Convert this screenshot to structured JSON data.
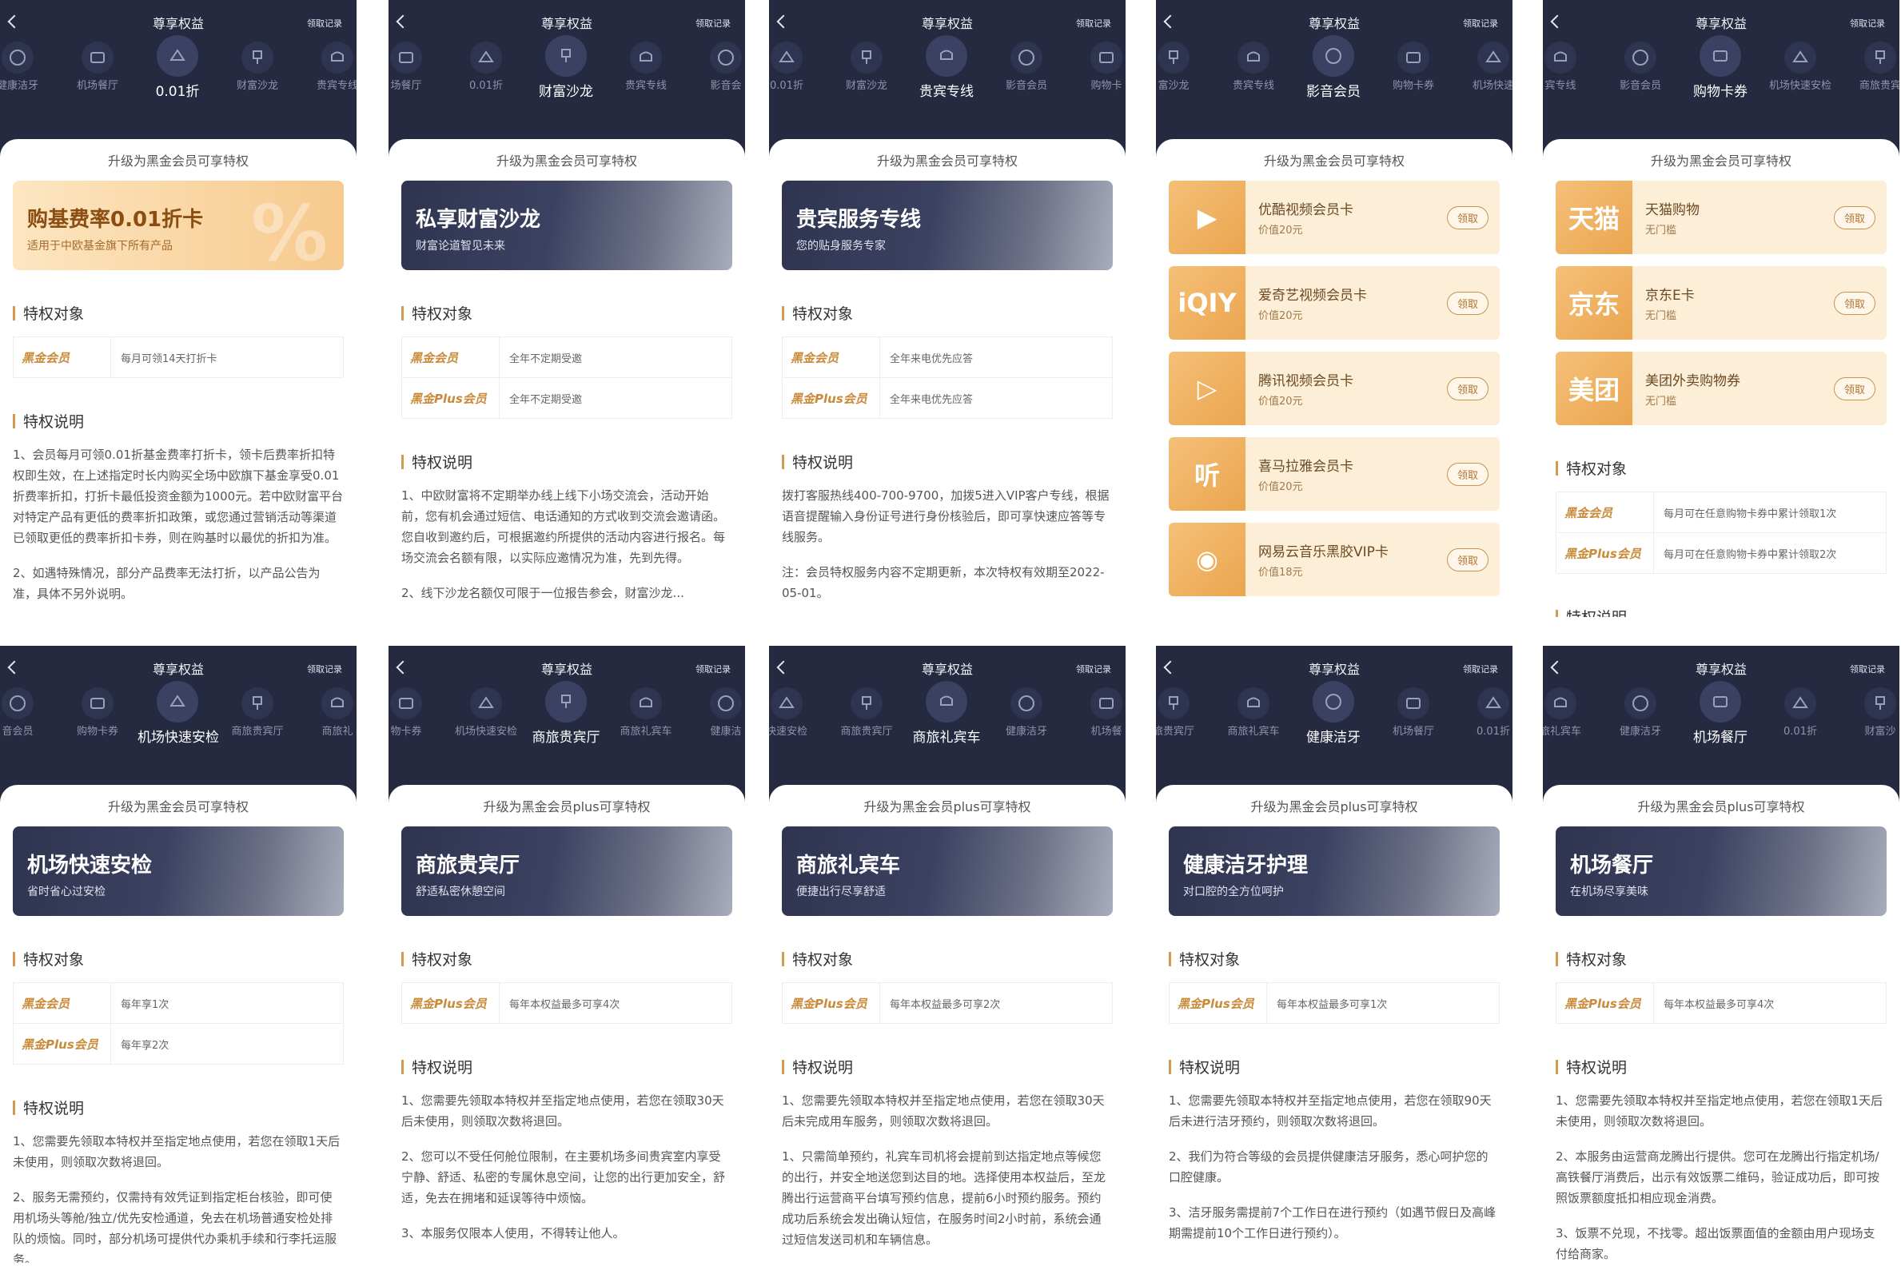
{
  "header": {
    "title": "尊享权益",
    "record": "领取记录",
    "back": "返回"
  },
  "icons": {
    "back": "chevron-left-icon"
  },
  "colors": {
    "header_bg": "#252a40",
    "accent": "#d39a4f",
    "gold_text": "#c98b3a"
  },
  "panels": [
    {
      "tabs": [
        "健康洁牙",
        "机场餐厅",
        "0.01折",
        "财富沙龙",
        "贵宾专线"
      ],
      "upgrade": "升级为黑金会员可享特权",
      "banner": {
        "title": "购基费率0.01折卡",
        "subtitle": "适用于中欧基金旗下所有产品",
        "style": "gold"
      },
      "target_title": "特权对象",
      "targets": [
        {
          "tier": "黑金会员",
          "value": "每月可领14天打折卡"
        }
      ],
      "desc_title": "特权说明",
      "desc": [
        "1、会员每月可领0.01折基金费率打折卡，领卡后费率折扣特权即生效，在上述指定时长内购买全场中欧旗下基金享受0.01折费率折扣，打折卡最低投资金额为1000元。若中欧财富平台对特定产品有更低的费率折扣政策，或您通过营销活动等渠道已领取更低的费率折扣卡券，则在购基时以最优的折扣为准。",
        "2、如遇特殊情况，部分产品费率无法打折，以产品公告为准，具体不另外说明。"
      ]
    },
    {
      "tabs": [
        "场餐厅",
        "0.01折",
        "财富沙龙",
        "贵宾专线",
        "影音会"
      ],
      "upgrade": "升级为黑金会员可享特权",
      "banner": {
        "title": "私享财富沙龙",
        "subtitle": "财富论道智见未来",
        "style": "dark"
      },
      "target_title": "特权对象",
      "targets": [
        {
          "tier": "黑金会员",
          "value": "全年不定期受邀"
        },
        {
          "tier": "黑金Plus会员",
          "value": "全年不定期受邀"
        }
      ],
      "desc_title": "特权说明",
      "desc": [
        "1、中欧财富将不定期举办线上线下小场交流会，活动开始前，您有机会通过短信、电话通知的方式收到交流会邀请函。您自收到邀约后，可根据邀约所提供的活动内容进行报名。每场交流会名额有限，以实际应邀情况为准，先到先得。",
        "2、线下沙龙名额仅可限于一位报告参会，财富沙龙..."
      ]
    },
    {
      "tabs": [
        "0.01折",
        "财富沙龙",
        "贵宾专线",
        "影音会员",
        "购物卡"
      ],
      "upgrade": "升级为黑金会员可享特权",
      "banner": {
        "title": "贵宾服务专线",
        "subtitle": "您的贴身服务专家",
        "style": "dark"
      },
      "target_title": "特权对象",
      "targets": [
        {
          "tier": "黑金会员",
          "value": "全年来电优先应答"
        },
        {
          "tier": "黑金Plus会员",
          "value": "全年来电优先应答"
        }
      ],
      "desc_title": "特权说明",
      "desc": [
        "拨打客服热线400-700-9700，加拨5进入VIP客户专线，根据语音提醒输入身份证号进行身份核验后，即可享快速应答等专线服务。",
        "注：会员特权服务内容不定期更新，本次特权有效期至2022-05-01。"
      ]
    },
    {
      "tabs": [
        "富沙龙",
        "贵宾专线",
        "影音会员",
        "购物卡券",
        "机场快速"
      ],
      "upgrade": "升级为黑金会员可享特权",
      "vouchers": [
        {
          "logo": "▶",
          "name": "优酷视频会员卡",
          "price": "价值20元",
          "btn": "领取"
        },
        {
          "logo": "iQIY",
          "name": "爱奇艺视频会员卡",
          "price": "价值20元",
          "btn": "领取"
        },
        {
          "logo": "▷",
          "name": "腾讯视频会员卡",
          "price": "价值20元",
          "btn": "领取"
        },
        {
          "logo": "听",
          "name": "喜马拉雅会员卡",
          "price": "价值20元",
          "btn": "领取"
        },
        {
          "logo": "◉",
          "name": "网易云音乐黑胶VIP卡",
          "price": "价值18元",
          "btn": "领取"
        }
      ]
    },
    {
      "tabs": [
        "宾专线",
        "影音会员",
        "购物卡券",
        "机场快速安检",
        "商旅贵宾"
      ],
      "upgrade": "升级为黑金会员可享特权",
      "vouchers": [
        {
          "logo": "天猫",
          "name": "天猫购物",
          "price": "无门槛",
          "btn": "领取"
        },
        {
          "logo": "京东",
          "name": "京东E卡",
          "price": "无门槛",
          "btn": "领取"
        },
        {
          "logo": "美团",
          "name": "美团外卖购物券",
          "price": "无门槛",
          "btn": "领取"
        }
      ],
      "target_title": "特权对象",
      "targets": [
        {
          "tier": "黑金会员",
          "value": "每月可在任意购物卡券中累计领取1次"
        },
        {
          "tier": "黑金Plus会员",
          "value": "每月可在任意购物卡券中累计领取2次"
        }
      ],
      "desc_title": "特权说明"
    },
    {
      "tabs": [
        "音会员",
        "购物卡券",
        "机场快速安检",
        "商旅贵宾厅",
        "商旅礼"
      ],
      "upgrade": "升级为黑金会员可享特权",
      "banner": {
        "title": "机场快速安检",
        "subtitle": "省时省心过安检",
        "style": "dark"
      },
      "target_title": "特权对象",
      "targets": [
        {
          "tier": "黑金会员",
          "value": "每年享1次"
        },
        {
          "tier": "黑金Plus会员",
          "value": "每年享2次"
        }
      ],
      "desc_title": "特权说明",
      "desc": [
        "1、您需要先领取本特权并至指定地点使用，若您在领取1天后未使用，则领取次数将退回。",
        "2、服务无需预约，仅需持有效凭证到指定柜台核验，即可使用机场头等舱/独立/优先安检通道，免去在机场普通安检处排队的烦恼。同时，部分机场可提供代办乘机手续和行李托运服务。"
      ]
    },
    {
      "tabs": [
        "物卡券",
        "机场快速安检",
        "商旅贵宾厅",
        "商旅礼宾车",
        "健康洁"
      ],
      "upgrade": "升级为黑金会员plus可享特权",
      "banner": {
        "title": "商旅贵宾厅",
        "subtitle": "舒适私密休憩空间",
        "style": "dark"
      },
      "target_title": "特权对象",
      "targets": [
        {
          "tier": "黑金Plus会员",
          "value": "每年本权益最多可享4次"
        }
      ],
      "desc_title": "特权说明",
      "desc": [
        "1、您需要先领取本特权并至指定地点使用，若您在领取30天后未使用，则领取次数将退回。",
        "2、您可以不受任何舱位限制，在主要机场多间贵宾室内享受宁静、舒适、私密的专属休息空间，让您的出行更加安全，舒适，免去在拥堵和延误等待中烦恼。",
        "3、本服务仅限本人使用，不得转让他人。"
      ]
    },
    {
      "tabs": [
        "快速安检",
        "商旅贵宾厅",
        "商旅礼宾车",
        "健康洁牙",
        "机场餐"
      ],
      "upgrade": "升级为黑金会员plus可享特权",
      "banner": {
        "title": "商旅礼宾车",
        "subtitle": "便捷出行尽享舒适",
        "style": "dark"
      },
      "target_title": "特权对象",
      "targets": [
        {
          "tier": "黑金Plus会员",
          "value": "每年本权益最多可享2次"
        }
      ],
      "desc_title": "特权说明",
      "desc": [
        "1、您需要先领取本特权并至指定地点使用，若您在领取30天后未完成用车服务，则领取次数将退回。",
        "1、只需简单预约，礼宾车司机将会提前到达指定地点等候您的出行，并安全地送您到达目的地。选择使用本权益后，至龙腾出行运营商平台填写预约信息，提前6小时预约服务。预约成功后系统会发出确认短信，在服务时间2小时前，系统会通过短信发送司机和车辆信息。"
      ]
    },
    {
      "tabs": [
        "旅贵宾厅",
        "商旅礼宾车",
        "健康洁牙",
        "机场餐厅",
        "0.01折"
      ],
      "upgrade": "升级为黑金会员plus可享特权",
      "banner": {
        "title": "健康洁牙护理",
        "subtitle": "对口腔的全方位呵护",
        "style": "dark"
      },
      "target_title": "特权对象",
      "targets": [
        {
          "tier": "黑金Plus会员",
          "value": "每年本权益最多可享1次"
        }
      ],
      "desc_title": "特权说明",
      "desc": [
        "1、您需要先领取本特权并至指定地点使用，若您在领取90天后未进行洁牙预约，则领取次数将退回。",
        "2、我们为符合等级的会员提供健康洁牙服务，悉心呵护您的口腔健康。",
        "3、洁牙服务需提前7个工作日在进行预约（如遇节假日及高峰期需提前10个工作日进行预约）。"
      ]
    },
    {
      "tabs": [
        "旅礼宾车",
        "健康洁牙",
        "机场餐厅",
        "0.01折",
        "财富沙"
      ],
      "upgrade": "升级为黑金会员plus可享特权",
      "banner": {
        "title": "机场餐厅",
        "subtitle": "在机场尽享美味",
        "style": "dark"
      },
      "target_title": "特权对象",
      "targets": [
        {
          "tier": "黑金Plus会员",
          "value": "每年本权益最多可享4次"
        }
      ],
      "desc_title": "特权说明",
      "desc": [
        "1、您需要先领取本特权并至指定地点使用，若您在领取1天后未使用，则领取次数将退回。",
        "2、本服务由运营商龙腾出行提供。您可在龙腾出行指定机场/高铁餐厅消费后，出示有效饭票二维码，验证成功后，即可按照饭票额度抵扣相应现金消费。",
        "3、饭票不兑现，不找零。超出饭票面值的金额由用户现场支付给商家。"
      ]
    }
  ]
}
